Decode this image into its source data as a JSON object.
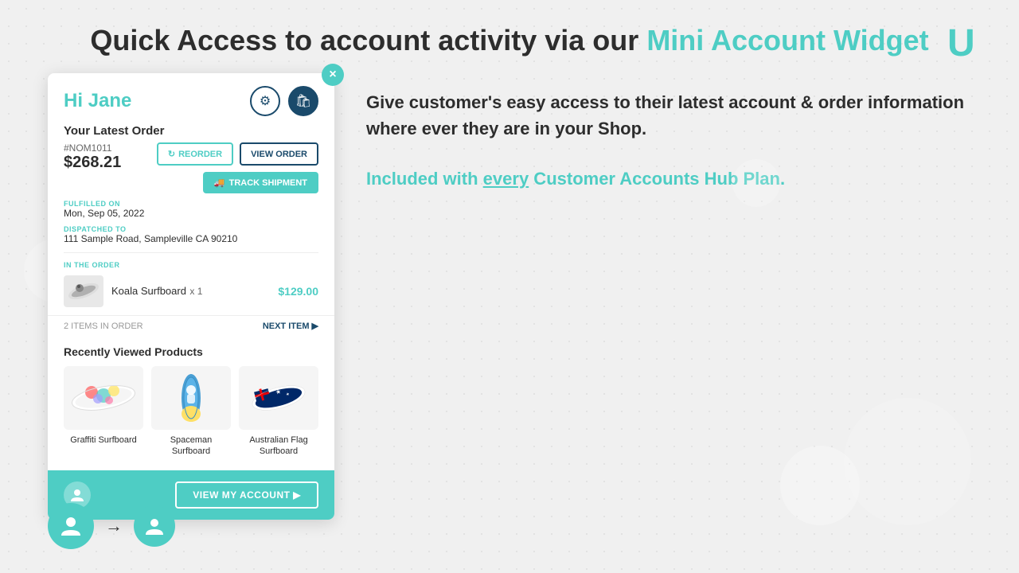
{
  "header": {
    "title_plain": "Quick Access to account activity via our ",
    "title_accent": "Mini Account Widget"
  },
  "logo": {
    "symbol": "U"
  },
  "widget": {
    "greeting": "Hi Jane",
    "close_label": "×",
    "icons": {
      "settings": "⚙",
      "bag": "🛍"
    },
    "latest_order": {
      "section_title": "Your Latest Order",
      "order_id": "#NOM1011",
      "price": "$268.21",
      "fulfilled_label": "FULFILLED ON",
      "fulfilled_date": "Mon, Sep 05, 2022",
      "dispatched_label": "DISPATCHED TO",
      "dispatched_address": "111 Sample Road, Sampleville CA 90210",
      "in_order_label": "IN THE ORDER",
      "buttons": {
        "reorder": "REORDER",
        "view_order": "VIEW ORDER",
        "track_shipment": "TRACK SHIPMENT",
        "track_icon": "🚚"
      },
      "item": {
        "name": "Koala Surfboard",
        "qty": "x 1",
        "price": "$129.00"
      },
      "items_count": "2 ITEMS IN ORDER",
      "next_item": "NEXT ITEM ▶"
    },
    "recently_viewed": {
      "title": "Recently Viewed Products",
      "items": [
        {
          "name": "Graffiti Surfboard"
        },
        {
          "name": "Spaceman Surfboard"
        },
        {
          "name": "Australian Flag Surfboard"
        }
      ]
    },
    "footer": {
      "view_account": "VIEW MY ACCOUNT ▶"
    }
  },
  "right_panel": {
    "main_text": "Give customer's easy access to their latest account & order information where ever they are in your Shop.",
    "sub_text_plain": "Included with ",
    "sub_text_accent": "every",
    "sub_text_end": " Customer Accounts Hub Plan."
  }
}
